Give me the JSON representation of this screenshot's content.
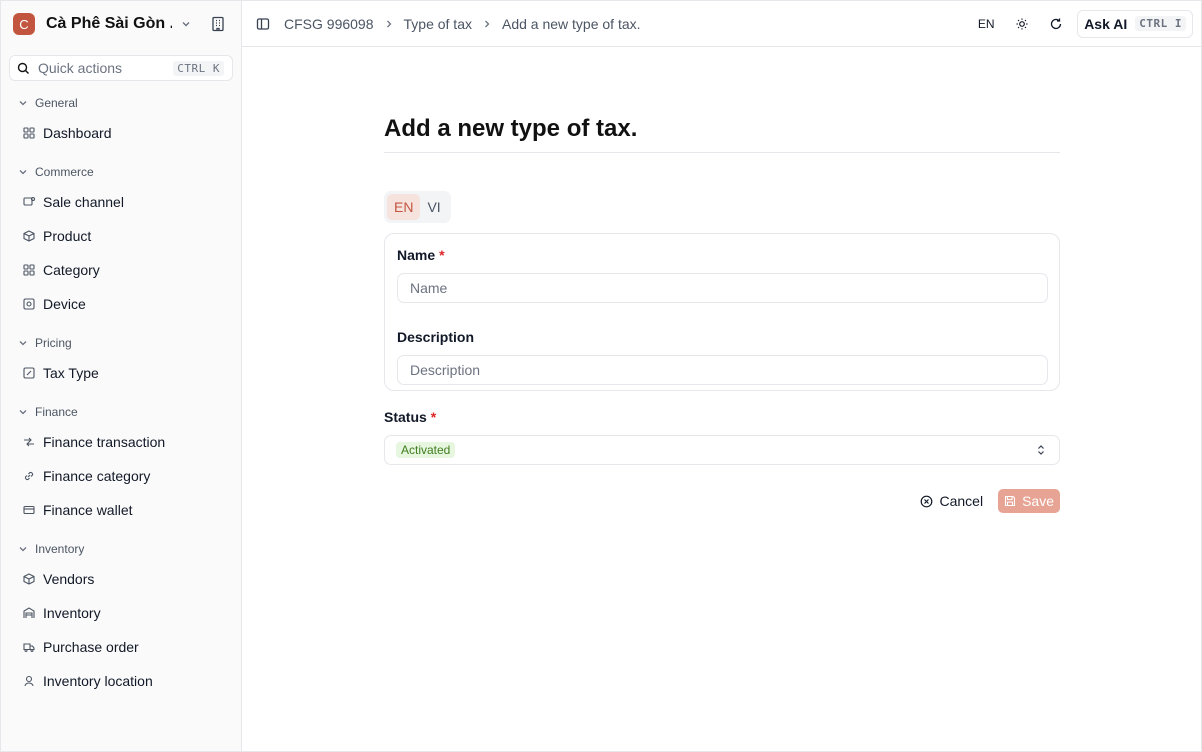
{
  "brand": {
    "logo_letter": "C",
    "name": "Cà Phê Sài Gòn ..."
  },
  "quick_actions": {
    "label": "Quick actions",
    "shortcut": "CTRL K"
  },
  "sidebar": {
    "groups": [
      {
        "title": "General",
        "items": [
          {
            "label": "Dashboard",
            "icon": "grid-icon"
          }
        ]
      },
      {
        "title": "Commerce",
        "items": [
          {
            "label": "Sale channel",
            "icon": "channel-icon"
          },
          {
            "label": "Product",
            "icon": "box-icon"
          },
          {
            "label": "Category",
            "icon": "grid-icon"
          },
          {
            "label": "Device",
            "icon": "device-icon"
          }
        ]
      },
      {
        "title": "Pricing",
        "items": [
          {
            "label": "Tax Type",
            "icon": "percent-icon"
          }
        ]
      },
      {
        "title": "Finance",
        "items": [
          {
            "label": "Finance transaction",
            "icon": "transaction-icon"
          },
          {
            "label": "Finance category",
            "icon": "link-icon"
          },
          {
            "label": "Finance wallet",
            "icon": "wallet-icon"
          }
        ]
      },
      {
        "title": "Inventory",
        "items": [
          {
            "label": "Vendors",
            "icon": "box-icon"
          },
          {
            "label": "Inventory",
            "icon": "warehouse-icon"
          },
          {
            "label": "Purchase order",
            "icon": "truck-icon"
          },
          {
            "label": "Inventory location",
            "icon": "location-icon"
          }
        ]
      }
    ]
  },
  "topbar": {
    "breadcrumbs": [
      "CFSG 996098",
      "Type of tax",
      "Add a new type of tax."
    ],
    "language": "EN",
    "ask_ai": {
      "label": "Ask AI",
      "shortcut": "CTRL I"
    }
  },
  "form": {
    "title": "Add a new type of tax.",
    "lang_tabs": [
      "EN",
      "VI"
    ],
    "active_lang": "EN",
    "name": {
      "label": "Name",
      "required_mark": "*",
      "placeholder": "Name"
    },
    "description": {
      "label": "Description",
      "placeholder": "Description"
    },
    "status": {
      "label": "Status",
      "required_mark": "*",
      "value": "Activated"
    },
    "cancel_label": "Cancel",
    "save_label": "Save"
  },
  "colors": {
    "accent": "#c2553f",
    "save_disabled": "#e7a394",
    "badge_bg": "#e7f6df",
    "badge_text": "#3f7d20"
  }
}
